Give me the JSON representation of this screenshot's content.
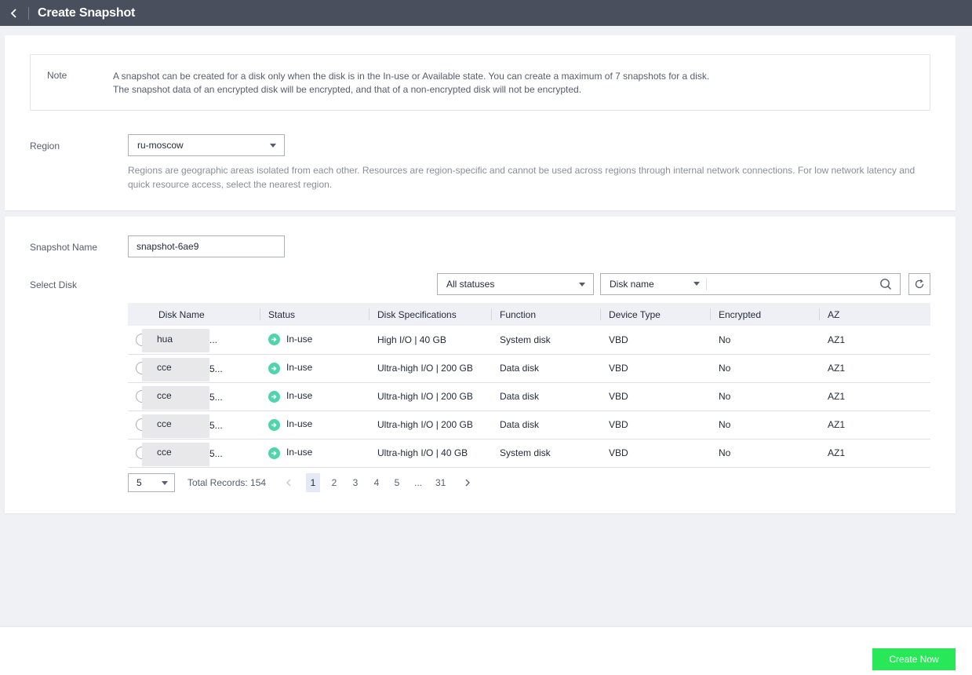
{
  "header": {
    "title": "Create Snapshot",
    "back_icon": "chevron-left-icon"
  },
  "note": {
    "label": "Note",
    "line1": "A snapshot can be created for a disk only when the disk is in the In-use or Available state. You can create a maximum of 7 snapshots for a disk.",
    "line2": "The snapshot data of an encrypted disk will be encrypted, and that of a non-encrypted disk will not be encrypted."
  },
  "region": {
    "label": "Region",
    "value": "ru-moscow",
    "help": "Regions are geographic areas isolated from each other. Resources are region-specific and cannot be used across regions through internal network connections. For low network latency and quick resource access, select the nearest region."
  },
  "snapshot": {
    "label": "Snapshot Name",
    "value": "snapshot-6ae9"
  },
  "disk_select": {
    "label": "Select Disk",
    "status_filter": "All statuses",
    "search_field": "Disk name",
    "search_value": ""
  },
  "table": {
    "columns": [
      "Disk Name",
      "Status",
      "Disk Specifications",
      "Function",
      "Device Type",
      "Encrypted",
      "AZ"
    ],
    "rows": [
      {
        "name_prefix": "hua",
        "name_suffix": "...",
        "status": "In-use",
        "spec": "High I/O | 40 GB",
        "function": "System disk",
        "device": "VBD",
        "encrypted": "No",
        "az": "AZ1"
      },
      {
        "name_prefix": "cce",
        "name_suffix": "5...",
        "status": "In-use",
        "spec": "Ultra-high I/O | 200 GB",
        "function": "Data disk",
        "device": "VBD",
        "encrypted": "No",
        "az": "AZ1"
      },
      {
        "name_prefix": "cce",
        "name_suffix": "5...",
        "status": "In-use",
        "spec": "Ultra-high I/O | 200 GB",
        "function": "Data disk",
        "device": "VBD",
        "encrypted": "No",
        "az": "AZ1"
      },
      {
        "name_prefix": "cce",
        "name_suffix": "5...",
        "status": "In-use",
        "spec": "Ultra-high I/O | 200 GB",
        "function": "Data disk",
        "device": "VBD",
        "encrypted": "No",
        "az": "AZ1"
      },
      {
        "name_prefix": "cce",
        "name_suffix": "5...",
        "status": "In-use",
        "spec": "Ultra-high I/O | 40 GB",
        "function": "System disk",
        "device": "VBD",
        "encrypted": "No",
        "az": "AZ1"
      }
    ]
  },
  "pagination": {
    "page_size": "5",
    "total": "Total Records: 154",
    "pages": [
      "1",
      "2",
      "3",
      "4",
      "5",
      "...",
      "31"
    ],
    "current": "1"
  },
  "footer": {
    "create_label": "Create Now"
  },
  "colors": {
    "topbar": "#4a4f5e",
    "primary_button": "#28e85a",
    "status_ok": "#50d4ab"
  }
}
